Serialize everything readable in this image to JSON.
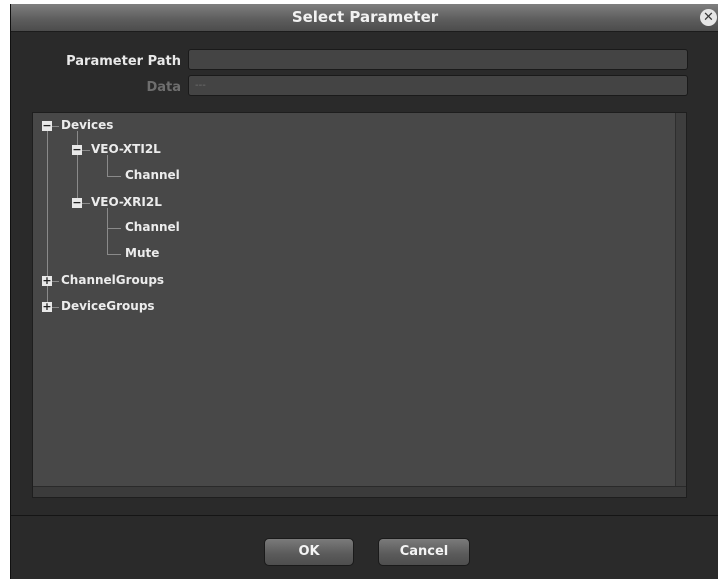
{
  "dialog": {
    "title": "Select Parameter",
    "close_glyph": "✕"
  },
  "form": {
    "parameter_path_label": "Parameter Path",
    "parameter_path_value": "",
    "data_label": "Data",
    "data_value": "---"
  },
  "tree": {
    "devices": {
      "label": "Devices",
      "expanded": true,
      "children": [
        {
          "label": "VEO-XTI2L",
          "expanded": true,
          "children": [
            "Channel"
          ]
        },
        {
          "label": "VEO-XRI2L",
          "expanded": true,
          "children": [
            "Channel",
            "Mute"
          ]
        }
      ]
    },
    "channel_groups": {
      "label": "ChannelGroups",
      "expanded": false
    },
    "device_groups": {
      "label": "DeviceGroups",
      "expanded": false
    },
    "expanded_glyph": "−",
    "collapsed_glyph": "+"
  },
  "buttons": {
    "ok": "OK",
    "cancel": "Cancel"
  }
}
